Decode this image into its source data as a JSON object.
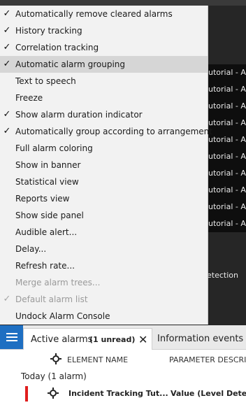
{
  "menu": {
    "items": [
      {
        "label": "Automatically remove cleared alarms",
        "checked": true
      },
      {
        "label": "History tracking",
        "checked": true
      },
      {
        "label": "Correlation tracking",
        "checked": true
      },
      {
        "label": "Automatic alarm grouping",
        "checked": true,
        "highlighted": true
      },
      {
        "label": "Text to speech",
        "checked": false
      },
      {
        "label": "Freeze",
        "checked": false
      },
      {
        "label": "Show alarm duration indicator",
        "checked": true
      },
      {
        "label": "Automatically group according to arrangement",
        "checked": true
      },
      {
        "label": "Full alarm coloring",
        "checked": false
      },
      {
        "label": "Show in banner",
        "checked": false
      },
      {
        "label": "Statistical view",
        "checked": false
      },
      {
        "label": "Reports view",
        "checked": false
      },
      {
        "label": "Show side panel",
        "checked": false
      },
      {
        "label": "Audible alert...",
        "checked": false
      },
      {
        "label": "Delay...",
        "checked": false
      },
      {
        "label": "Refresh rate...",
        "checked": false
      },
      {
        "label": "Merge alarm trees...",
        "checked": false,
        "disabled": true
      },
      {
        "label": "Default alarm list",
        "checked": true,
        "disabled": true
      },
      {
        "label": "Undock Alarm Console",
        "checked": false
      }
    ]
  },
  "background": {
    "row_texts": [
      "utorial - Ar",
      "utorial - Ar",
      "utorial - Ar",
      "utorial - Ar",
      "utorial - Ar",
      "utorial - Ar",
      "utorial - Ar",
      "utorial - Ar",
      "utorial - Ar",
      "utorial - Ar"
    ],
    "detection_text": "etection"
  },
  "console": {
    "menu_icon": "hamburger-icon",
    "tabs": [
      {
        "label": "Active alarms",
        "badge": "(1 unread)",
        "close": "✕"
      },
      {
        "label": "Information events"
      }
    ],
    "columns": {
      "element": "ELEMENT NAME",
      "parameter": "PARAMETER DESCRIP"
    },
    "group": {
      "label": "Today (1 alarm)"
    },
    "alarms": [
      {
        "element": "Incident Tracking Tut...",
        "parameter": "Value (Level Detect",
        "severity_color": "#e01e1e"
      }
    ]
  },
  "colors": {
    "accent": "#1e6fc2",
    "critical": "#e01e1e",
    "menu_bg": "#f2f2f2",
    "highlight": "#d6d6d6"
  }
}
